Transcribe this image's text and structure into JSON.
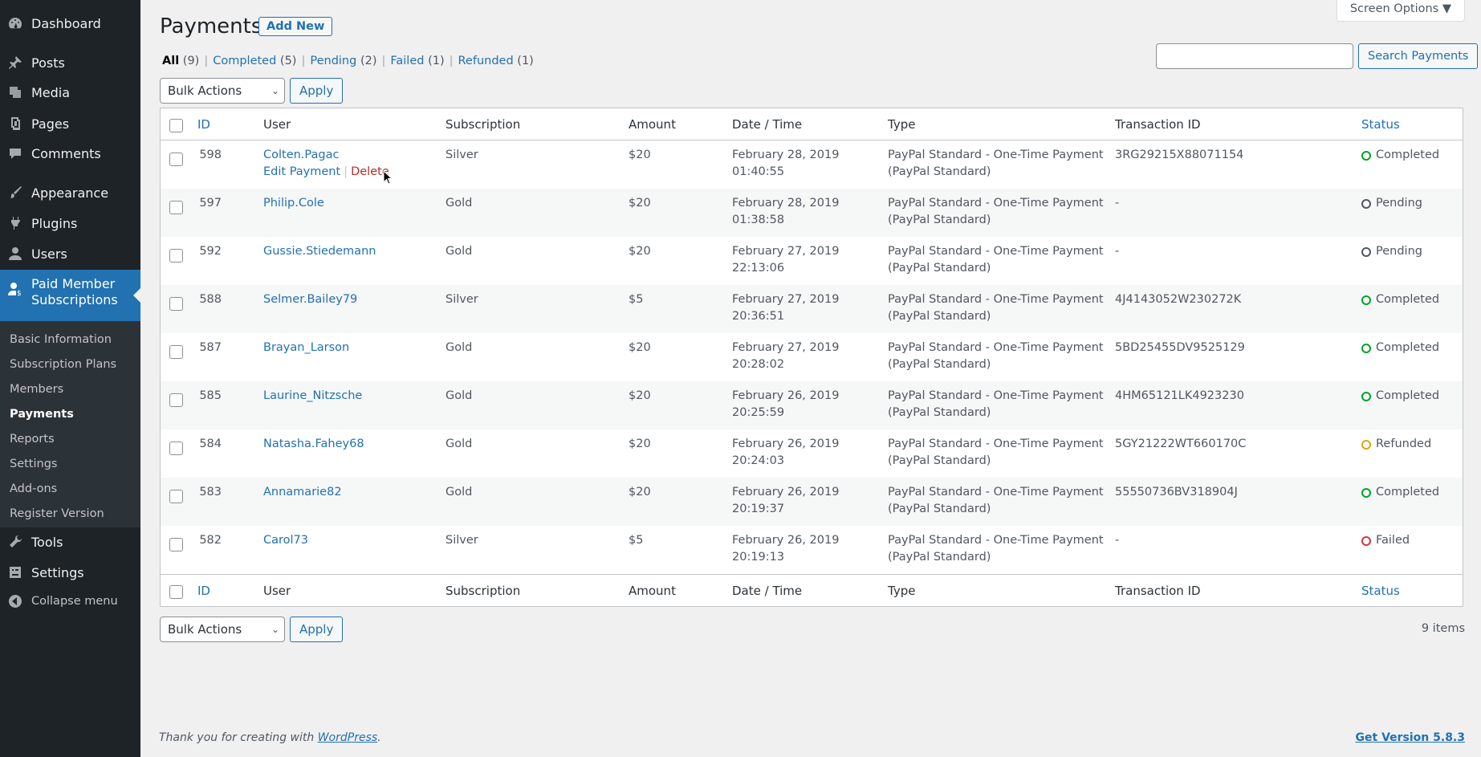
{
  "sidebar": {
    "items": [
      {
        "label": "Dashboard",
        "icon": "dashboard-icon"
      },
      {
        "label": "Posts",
        "icon": "pin-icon"
      },
      {
        "label": "Media",
        "icon": "media-icon"
      },
      {
        "label": "Pages",
        "icon": "pages-icon"
      },
      {
        "label": "Comments",
        "icon": "comments-icon"
      },
      {
        "label": "Appearance",
        "icon": "brush-icon"
      },
      {
        "label": "Plugins",
        "icon": "plugin-icon"
      },
      {
        "label": "Users",
        "icon": "users-icon"
      },
      {
        "label": "Paid Member Subscriptions",
        "icon": "member-icon"
      },
      {
        "label": "Tools",
        "icon": "wrench-icon"
      },
      {
        "label": "Settings",
        "icon": "settings-icon"
      },
      {
        "label": "Collapse menu",
        "icon": "collapse-icon"
      }
    ],
    "submenu": [
      "Basic Information",
      "Subscription Plans",
      "Members",
      "Payments",
      "Reports",
      "Settings",
      "Add-ons",
      "Register Version"
    ]
  },
  "header": {
    "title": "Payments",
    "add_new": "Add New",
    "screen_options": "Screen Options ▼"
  },
  "filters": {
    "all": "All",
    "all_count": "(9)",
    "completed": "Completed",
    "completed_count": "(5)",
    "pending": "Pending",
    "pending_count": "(2)",
    "failed": "Failed",
    "failed_count": "(1)",
    "refunded": "Refunded",
    "refunded_count": "(1)"
  },
  "search": {
    "value": "",
    "button": "Search Payments"
  },
  "bulk": {
    "label": "Bulk Actions",
    "apply": "Apply"
  },
  "columns": [
    "ID",
    "User",
    "Subscription",
    "Amount",
    "Date / Time",
    "Type",
    "Transaction ID",
    "Status"
  ],
  "row_actions": {
    "edit": "Edit Payment",
    "delete": "Delete",
    "sep": "|"
  },
  "rows": [
    {
      "id": "598",
      "user": "Colten.Pagac",
      "sub": "Silver",
      "amt": "$20",
      "date": "February 28, 2019",
      "time": "01:40:55",
      "type1": "PayPal Standard - One-Time Payment",
      "type2": "(PayPal Standard)",
      "tx": "3RG29215X88071154",
      "status": "Completed"
    },
    {
      "id": "597",
      "user": "Philip.Cole",
      "sub": "Gold",
      "amt": "$20",
      "date": "February 28, 2019",
      "time": "01:38:58",
      "type1": "PayPal Standard - One-Time Payment",
      "type2": "(PayPal Standard)",
      "tx": "-",
      "status": "Pending"
    },
    {
      "id": "592",
      "user": "Gussie.Stiedemann",
      "sub": "Gold",
      "amt": "$20",
      "date": "February 27, 2019",
      "time": "22:13:06",
      "type1": "PayPal Standard - One-Time Payment",
      "type2": "(PayPal Standard)",
      "tx": "-",
      "status": "Pending"
    },
    {
      "id": "588",
      "user": "Selmer.Bailey79",
      "sub": "Silver",
      "amt": "$5",
      "date": "February 27, 2019",
      "time": "20:36:51",
      "type1": "PayPal Standard - One-Time Payment",
      "type2": "(PayPal Standard)",
      "tx": "4J4143052W230272K",
      "status": "Completed"
    },
    {
      "id": "587",
      "user": "Brayan_Larson",
      "sub": "Gold",
      "amt": "$20",
      "date": "February 27, 2019",
      "time": "20:28:02",
      "type1": "PayPal Standard - One-Time Payment",
      "type2": "(PayPal Standard)",
      "tx": "5BD25455DV9525129",
      "status": "Completed"
    },
    {
      "id": "585",
      "user": "Laurine_Nitzsche",
      "sub": "Gold",
      "amt": "$20",
      "date": "February 26, 2019",
      "time": "20:25:59",
      "type1": "PayPal Standard - One-Time Payment",
      "type2": "(PayPal Standard)",
      "tx": "4HM65121LK4923230",
      "status": "Completed"
    },
    {
      "id": "584",
      "user": "Natasha.Fahey68",
      "sub": "Gold",
      "amt": "$20",
      "date": "February 26, 2019",
      "time": "20:24:03",
      "type1": "PayPal Standard - One-Time Payment",
      "type2": "(PayPal Standard)",
      "tx": "5GY21222WT660170C",
      "status": "Refunded"
    },
    {
      "id": "583",
      "user": "Annamarie82",
      "sub": "Gold",
      "amt": "$20",
      "date": "February 26, 2019",
      "time": "20:19:37",
      "type1": "PayPal Standard - One-Time Payment",
      "type2": "(PayPal Standard)",
      "tx": "55550736BV318904J",
      "status": "Completed"
    },
    {
      "id": "582",
      "user": "Carol73",
      "sub": "Silver",
      "amt": "$5",
      "date": "February 26, 2019",
      "time": "20:19:13",
      "type1": "PayPal Standard - One-Time Payment",
      "type2": "(PayPal Standard)",
      "tx": "-",
      "status": "Failed"
    }
  ],
  "status_colors": {
    "Completed": "#00a32a",
    "Pending": "#50575e",
    "Refunded": "#dba617",
    "Failed": "#d63638"
  },
  "items_count": "9 items",
  "footer": {
    "thanks_prefix": "Thank you for creating with ",
    "thanks_link": "WordPress",
    "thanks_suffix": ".",
    "version": "Get Version 5.8.3"
  }
}
